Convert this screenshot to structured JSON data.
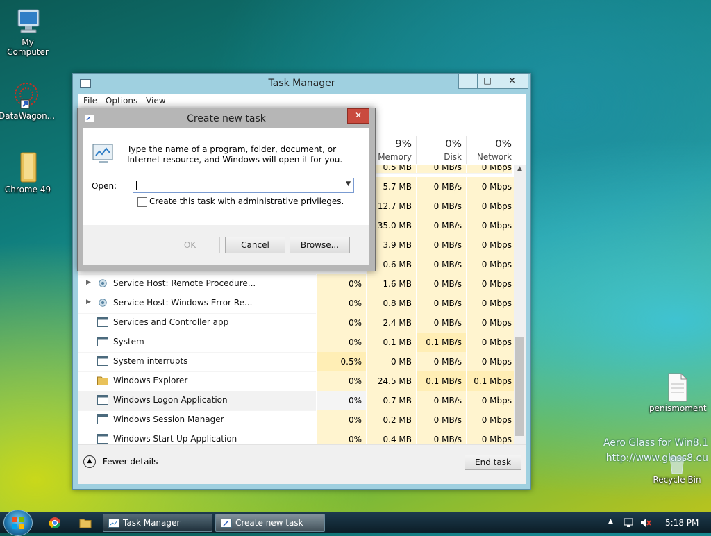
{
  "desktop": {
    "icons": [
      {
        "label": "My Computer"
      },
      {
        "label": "DataWagon..."
      },
      {
        "label": "Chrome 49"
      },
      {
        "label": "penismoment"
      },
      {
        "label": "Recycle Bin"
      }
    ],
    "watermark_line1": "Aero Glass for Win8.1",
    "watermark_line2": "http://www.glass8.eu"
  },
  "task_manager": {
    "title": "Task Manager",
    "menu": [
      "File",
      "Options",
      "View"
    ],
    "columns": [
      {
        "pct": "9%",
        "label": "Memory"
      },
      {
        "pct": "0%",
        "label": "Disk"
      },
      {
        "pct": "0%",
        "label": "Network"
      }
    ],
    "hidden_rows": [
      {
        "memory": "0.5 MB",
        "disk": "0 MB/s",
        "network": "0 Mbps"
      },
      {
        "memory": "5.7 MB",
        "disk": "0 MB/s",
        "network": "0 Mbps"
      },
      {
        "memory": "12.7 MB",
        "disk": "0 MB/s",
        "network": "0 Mbps"
      },
      {
        "memory": "35.0 MB",
        "disk": "0 MB/s",
        "network": "0 Mbps"
      },
      {
        "memory": "3.9 MB",
        "disk": "0 MB/s",
        "network": "0 Mbps"
      },
      {
        "memory": "0.6 MB",
        "disk": "0 MB/s",
        "network": "0 Mbps"
      }
    ],
    "rows": [
      {
        "name": "Service Host: Remote Procedure...",
        "cpu": "0%",
        "memory": "1.6 MB",
        "disk": "0 MB/s",
        "network": "0 Mbps"
      },
      {
        "name": "Service Host: Windows Error Re...",
        "cpu": "0%",
        "memory": "0.8 MB",
        "disk": "0 MB/s",
        "network": "0 Mbps"
      },
      {
        "name": "Services and Controller app",
        "cpu": "0%",
        "memory": "2.4 MB",
        "disk": "0 MB/s",
        "network": "0 Mbps"
      },
      {
        "name": "System",
        "cpu": "0%",
        "memory": "0.1 MB",
        "disk": "0.1 MB/s",
        "network": "0 Mbps"
      },
      {
        "name": "System interrupts",
        "cpu": "0.5%",
        "memory": "0 MB",
        "disk": "0 MB/s",
        "network": "0 Mbps"
      },
      {
        "name": "Windows Explorer",
        "cpu": "0%",
        "memory": "24.5 MB",
        "disk": "0.1 MB/s",
        "network": "0.1 Mbps"
      },
      {
        "name": "Windows Logon Application",
        "cpu": "0%",
        "memory": "0.7 MB",
        "disk": "0 MB/s",
        "network": "0 Mbps"
      },
      {
        "name": "Windows Session Manager",
        "cpu": "0%",
        "memory": "0.2 MB",
        "disk": "0 MB/s",
        "network": "0 Mbps"
      },
      {
        "name": "Windows Start-Up Application",
        "cpu": "0%",
        "memory": "0.4 MB",
        "disk": "0 MB/s",
        "network": "0 Mbps"
      }
    ],
    "fewer_details": "Fewer details",
    "end_task": "End task"
  },
  "dialog": {
    "title": "Create new task",
    "description": "Type the name of a program, folder, document, or Internet resource, and Windows will open it for you.",
    "open_label": "Open:",
    "open_value": "",
    "admin_checkbox_label": "Create this task with administrative privileges.",
    "ok": "OK",
    "cancel": "Cancel",
    "browse": "Browse..."
  },
  "taskbar": {
    "items": [
      {
        "label": "Task Manager"
      },
      {
        "label": "Create new task"
      }
    ],
    "clock": "5:18 PM"
  }
}
